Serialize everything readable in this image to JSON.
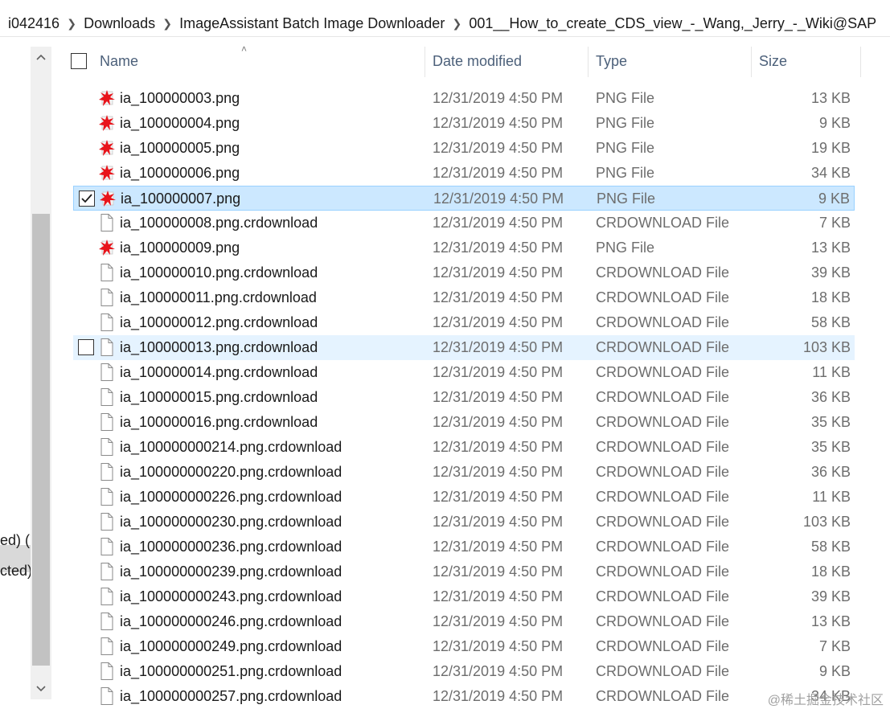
{
  "breadcrumb": [
    "i042416",
    "Downloads",
    "ImageAssistant Batch Image Downloader",
    "001__How_to_create_CDS_view_-_Wang,_Jerry_-_Wiki@SAP"
  ],
  "nav": {
    "text1": "ed) ('",
    "text2": "cted)"
  },
  "columns": {
    "name": "Name",
    "date": "Date modified",
    "type": "Type",
    "size": "Size"
  },
  "rows": [
    {
      "name": "ia_100000003.png",
      "date": "12/31/2019 4:50 PM",
      "type": "PNG File",
      "size": "13 KB",
      "icon": "png-icon"
    },
    {
      "name": "ia_100000004.png",
      "date": "12/31/2019 4:50 PM",
      "type": "PNG File",
      "size": "9 KB",
      "icon": "png-icon"
    },
    {
      "name": "ia_100000005.png",
      "date": "12/31/2019 4:50 PM",
      "type": "PNG File",
      "size": "19 KB",
      "icon": "png-icon"
    },
    {
      "name": "ia_100000006.png",
      "date": "12/31/2019 4:50 PM",
      "type": "PNG File",
      "size": "34 KB",
      "icon": "png-icon"
    },
    {
      "name": "ia_100000007.png",
      "date": "12/31/2019 4:50 PM",
      "type": "PNG File",
      "size": "9 KB",
      "icon": "png-icon",
      "state": "selected"
    },
    {
      "name": "ia_100000008.png.crdownload",
      "date": "12/31/2019 4:50 PM",
      "type": "CRDOWNLOAD File",
      "size": "7 KB",
      "icon": "file-icon"
    },
    {
      "name": "ia_100000009.png",
      "date": "12/31/2019 4:50 PM",
      "type": "PNG File",
      "size": "13 KB",
      "icon": "png-icon"
    },
    {
      "name": "ia_100000010.png.crdownload",
      "date": "12/31/2019 4:50 PM",
      "type": "CRDOWNLOAD File",
      "size": "39 KB",
      "icon": "file-icon"
    },
    {
      "name": "ia_100000011.png.crdownload",
      "date": "12/31/2019 4:50 PM",
      "type": "CRDOWNLOAD File",
      "size": "18 KB",
      "icon": "file-icon"
    },
    {
      "name": "ia_100000012.png.crdownload",
      "date": "12/31/2019 4:50 PM",
      "type": "CRDOWNLOAD File",
      "size": "58 KB",
      "icon": "file-icon"
    },
    {
      "name": "ia_100000013.png.crdownload",
      "date": "12/31/2019 4:50 PM",
      "type": "CRDOWNLOAD File",
      "size": "103 KB",
      "icon": "file-icon",
      "state": "hover"
    },
    {
      "name": "ia_100000014.png.crdownload",
      "date": "12/31/2019 4:50 PM",
      "type": "CRDOWNLOAD File",
      "size": "11 KB",
      "icon": "file-icon"
    },
    {
      "name": "ia_100000015.png.crdownload",
      "date": "12/31/2019 4:50 PM",
      "type": "CRDOWNLOAD File",
      "size": "36 KB",
      "icon": "file-icon"
    },
    {
      "name": "ia_100000016.png.crdownload",
      "date": "12/31/2019 4:50 PM",
      "type": "CRDOWNLOAD File",
      "size": "35 KB",
      "icon": "file-icon"
    },
    {
      "name": "ia_100000000214.png.crdownload",
      "date": "12/31/2019 4:50 PM",
      "type": "CRDOWNLOAD File",
      "size": "35 KB",
      "icon": "file-icon"
    },
    {
      "name": "ia_100000000220.png.crdownload",
      "date": "12/31/2019 4:50 PM",
      "type": "CRDOWNLOAD File",
      "size": "36 KB",
      "icon": "file-icon"
    },
    {
      "name": "ia_100000000226.png.crdownload",
      "date": "12/31/2019 4:50 PM",
      "type": "CRDOWNLOAD File",
      "size": "11 KB",
      "icon": "file-icon"
    },
    {
      "name": "ia_100000000230.png.crdownload",
      "date": "12/31/2019 4:50 PM",
      "type": "CRDOWNLOAD File",
      "size": "103 KB",
      "icon": "file-icon"
    },
    {
      "name": "ia_100000000236.png.crdownload",
      "date": "12/31/2019 4:50 PM",
      "type": "CRDOWNLOAD File",
      "size": "58 KB",
      "icon": "file-icon"
    },
    {
      "name": "ia_100000000239.png.crdownload",
      "date": "12/31/2019 4:50 PM",
      "type": "CRDOWNLOAD File",
      "size": "18 KB",
      "icon": "file-icon"
    },
    {
      "name": "ia_100000000243.png.crdownload",
      "date": "12/31/2019 4:50 PM",
      "type": "CRDOWNLOAD File",
      "size": "39 KB",
      "icon": "file-icon"
    },
    {
      "name": "ia_100000000246.png.crdownload",
      "date": "12/31/2019 4:50 PM",
      "type": "CRDOWNLOAD File",
      "size": "13 KB",
      "icon": "file-icon"
    },
    {
      "name": "ia_100000000249.png.crdownload",
      "date": "12/31/2019 4:50 PM",
      "type": "CRDOWNLOAD File",
      "size": "7 KB",
      "icon": "file-icon"
    },
    {
      "name": "ia_100000000251.png.crdownload",
      "date": "12/31/2019 4:50 PM",
      "type": "CRDOWNLOAD File",
      "size": "9 KB",
      "icon": "file-icon"
    },
    {
      "name": "ia_100000000257.png.crdownload",
      "date": "12/31/2019 4:50 PM",
      "type": "CRDOWNLOAD File",
      "size": "34 KB",
      "icon": "file-icon"
    }
  ],
  "watermark": "@稀土掘金技术社区",
  "colors": {
    "selected_bg": "#cce8ff",
    "selected_border": "#99d1ff",
    "hover_bg": "#e5f3ff",
    "header_text": "#4c607a",
    "png_icon_red": "#e8141b"
  }
}
